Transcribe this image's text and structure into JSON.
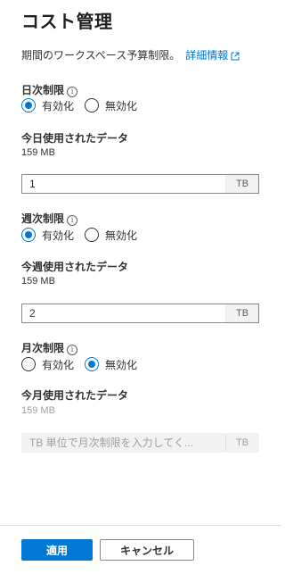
{
  "title": "コスト管理",
  "description": {
    "text": "期間のワークスペース予算制限。",
    "link_label": "詳細情報"
  },
  "radio_options": {
    "enabled": "有効化",
    "disabled": "無効化"
  },
  "daily": {
    "label": "日次制限",
    "selected": "enabled",
    "usage_label": "今日使用されたデータ",
    "usage_value": "159 MB",
    "input_value": "1",
    "unit": "TB"
  },
  "weekly": {
    "label": "週次制限",
    "selected": "enabled",
    "usage_label": "今週使用されたデータ",
    "usage_value": "159 MB",
    "input_value": "2",
    "unit": "TB"
  },
  "monthly": {
    "label": "月次制限",
    "selected": "disabled",
    "usage_label": "今月使用されたデータ",
    "usage_value": "159 MB",
    "input_placeholder": "TB 単位で月次制限を入力してく...",
    "unit": "TB"
  },
  "footer": {
    "apply_label": "適用",
    "cancel_label": "キャンセル"
  },
  "colors": {
    "accent": "#0078d4",
    "text": "#323130",
    "disabled_text": "#a19f9d"
  }
}
